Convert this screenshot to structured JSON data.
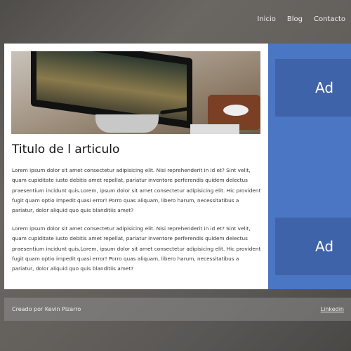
{
  "nav": {
    "items": [
      "Inicio",
      "Blog",
      "Contacto"
    ]
  },
  "article": {
    "title": "Titulo de l articulo",
    "paragraphs": [
      "Lorem ipsum dolor sit amet consectetur adipisicing elit. Nisi reprehenderit in id et? Sint velit, quam cupiditate iusto debitis amet repellat, pariatur inventore perferendis quidem delectus praesentium incidunt quis.Lorem, ipsum dolor sit amet consectetur adipisicing elit. Hic provident fugit quam optio impedit quasi error! Porro quas aliquam, libero harum, necessitatibus a pariatur, dolor aliquid quo quis blanditiis amet?",
      "Lorem ipsum dolor sit amet consectetur adipisicing elit. Nisi reprehenderit in id et? Sint velit, quam cupiditate iusto debitis amet repellat, pariatur inventore perferendis quidem delectus praesentium incidunt quis.Lorem, ipsum dolor sit amet consectetur adipisicing elit. Hic provident fugit quam optio impedit quasi error! Porro quas aliquam, libero harum, necessitatibus a pariatur, dolor aliquid quo quis blanditiis amet?"
    ]
  },
  "sidebar": {
    "ads": [
      "Ad",
      "Ad"
    ],
    "color": "#4a76c4",
    "ad_color": "#3f63a8"
  },
  "footer": {
    "credit": "Creado por Kevin Pizarro",
    "link": "Linkedin"
  }
}
